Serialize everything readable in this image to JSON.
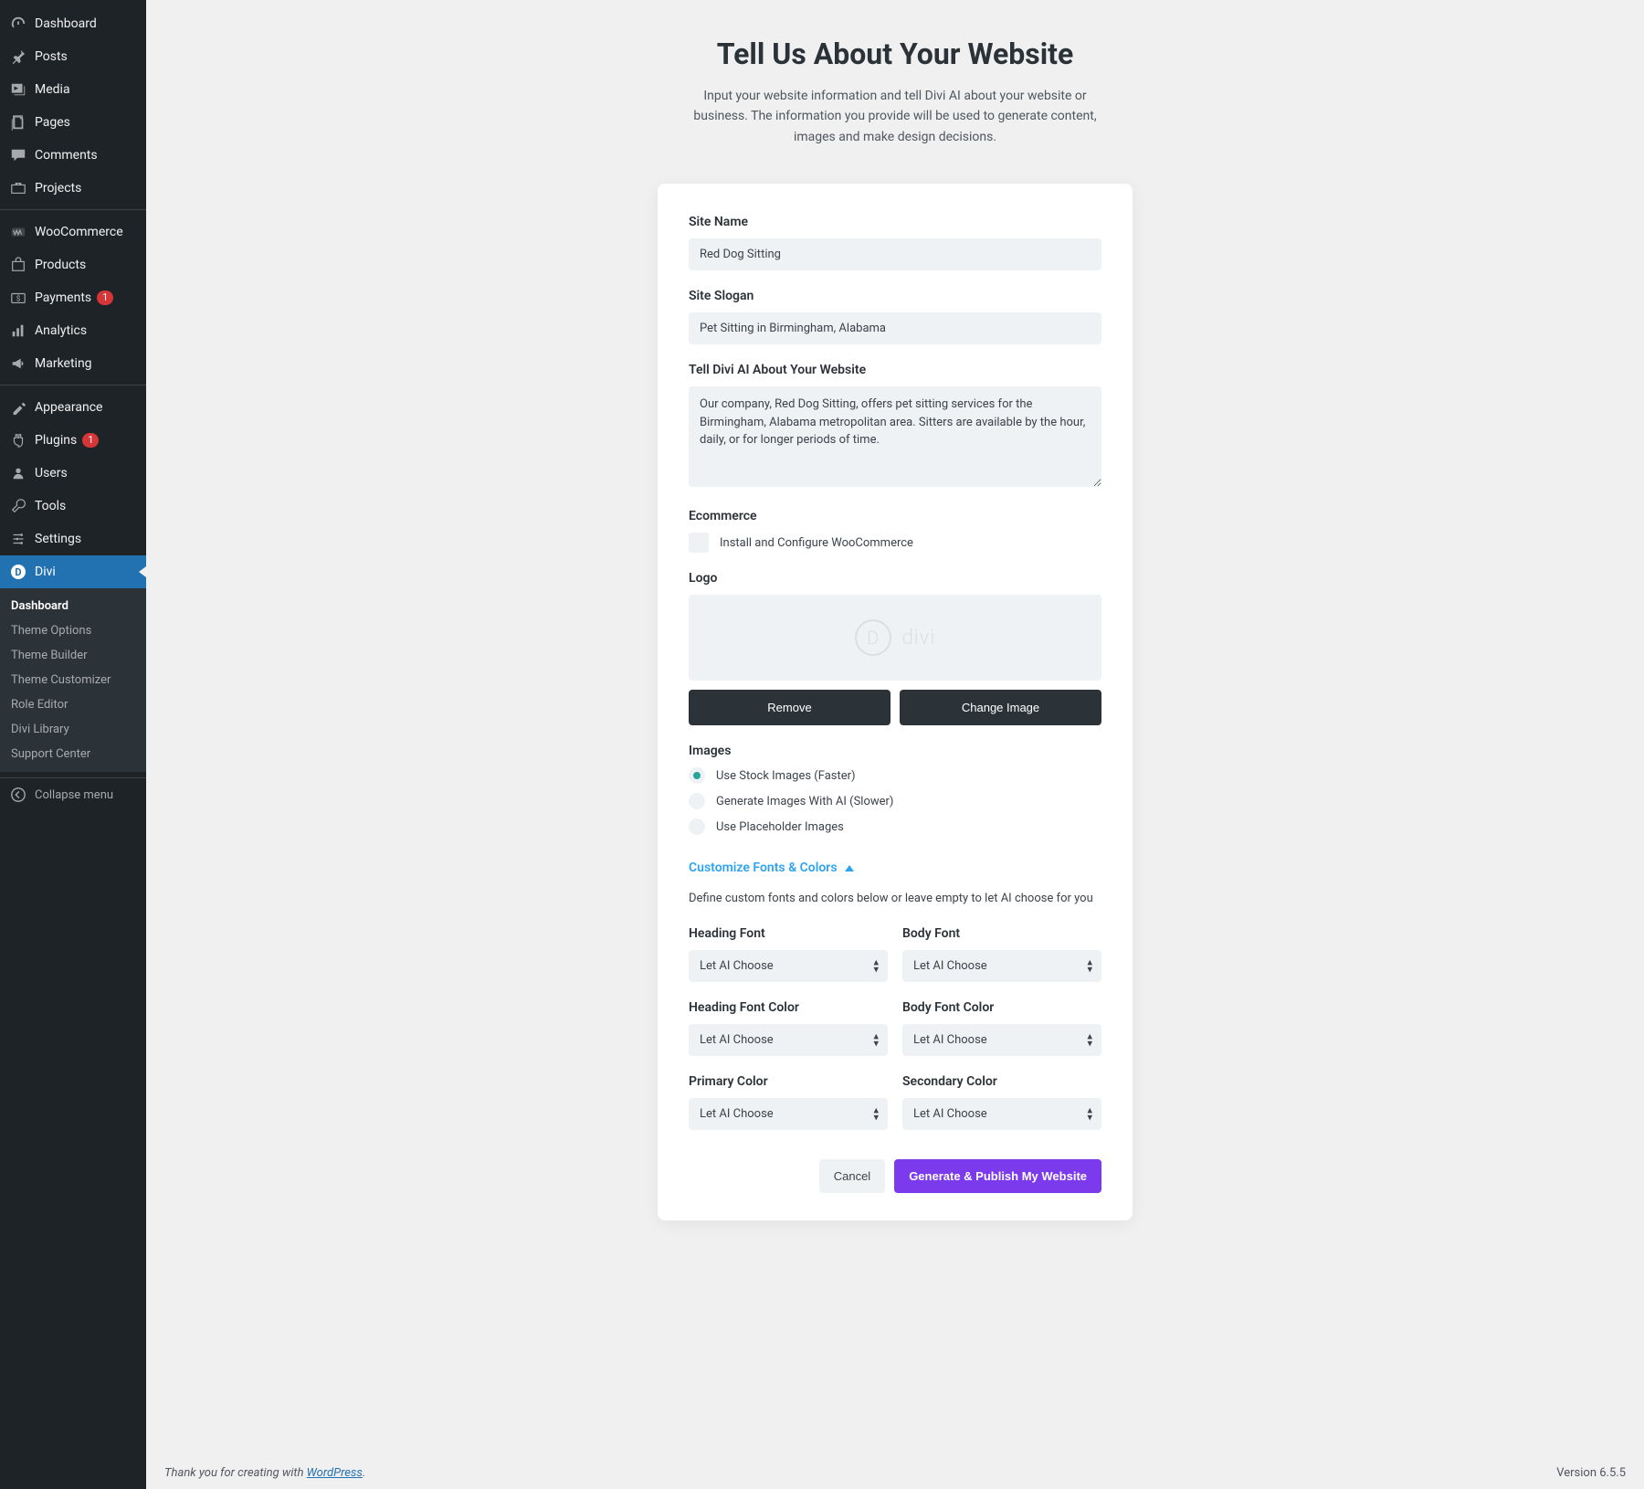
{
  "sidebar": {
    "items": [
      {
        "label": "Dashboard",
        "icon": "dashboard",
        "name": "sidebar-item-dashboard"
      },
      {
        "label": "Posts",
        "icon": "pin",
        "name": "sidebar-item-posts"
      },
      {
        "label": "Media",
        "icon": "media",
        "name": "sidebar-item-media"
      },
      {
        "label": "Pages",
        "icon": "page",
        "name": "sidebar-item-pages"
      },
      {
        "label": "Comments",
        "icon": "comment",
        "name": "sidebar-item-comments"
      },
      {
        "label": "Projects",
        "icon": "portfolio",
        "name": "sidebar-item-projects"
      },
      {
        "label": "WooCommerce",
        "icon": "woo",
        "name": "sidebar-item-woocommerce"
      },
      {
        "label": "Products",
        "icon": "product",
        "name": "sidebar-item-products"
      },
      {
        "label": "Payments",
        "icon": "payments",
        "badge": "1",
        "name": "sidebar-item-payments"
      },
      {
        "label": "Analytics",
        "icon": "analytics",
        "name": "sidebar-item-analytics"
      },
      {
        "label": "Marketing",
        "icon": "marketing",
        "name": "sidebar-item-marketing"
      },
      {
        "label": "Appearance",
        "icon": "appearance",
        "name": "sidebar-item-appearance"
      },
      {
        "label": "Plugins",
        "icon": "plugins",
        "badge": "1",
        "name": "sidebar-item-plugins"
      },
      {
        "label": "Users",
        "icon": "users",
        "name": "sidebar-item-users"
      },
      {
        "label": "Tools",
        "icon": "tools",
        "name": "sidebar-item-tools"
      },
      {
        "label": "Settings",
        "icon": "settings",
        "name": "sidebar-item-settings"
      },
      {
        "label": "Divi",
        "icon": "divi",
        "active": true,
        "name": "sidebar-item-divi"
      }
    ],
    "submenu": [
      {
        "label": "Dashboard",
        "current": true
      },
      {
        "label": "Theme Options"
      },
      {
        "label": "Theme Builder"
      },
      {
        "label": "Theme Customizer"
      },
      {
        "label": "Role Editor"
      },
      {
        "label": "Divi Library"
      },
      {
        "label": "Support Center"
      }
    ],
    "collapse": "Collapse menu"
  },
  "header": {
    "title": "Tell Us About Your Website",
    "subtitle": "Input your website information and tell Divi AI about your website or business. The information you provide will be used to generate content, images and make design decisions."
  },
  "form": {
    "site_name_label": "Site Name",
    "site_name_value": "Red Dog Sitting",
    "site_slogan_label": "Site Slogan",
    "site_slogan_value": "Pet Sitting in Birmingham, Alabama",
    "about_label": "Tell Divi AI About Your Website",
    "about_value": "Our company, Red Dog Sitting, offers pet sitting services for the Birmingham, Alabama metropolitan area. Sitters are available by the hour, daily, or for longer periods of time.",
    "ecommerce_label": "Ecommerce",
    "ecommerce_checkbox_label": "Install and Configure WooCommerce",
    "logo_label": "Logo",
    "logo_placeholder_text": "divi",
    "remove_btn": "Remove",
    "change_btn": "Change Image",
    "images_label": "Images",
    "image_options": [
      {
        "label": "Use Stock Images (Faster)",
        "checked": true
      },
      {
        "label": "Generate Images With AI (Slower)",
        "checked": false
      },
      {
        "label": "Use Placeholder Images",
        "checked": false
      }
    ],
    "customize_toggle": "Customize Fonts & Colors",
    "customize_help": "Define custom fonts and colors below or leave empty to let AI choose for you",
    "selects": [
      {
        "label": "Heading Font",
        "value": "Let AI Choose"
      },
      {
        "label": "Body Font",
        "value": "Let AI Choose"
      },
      {
        "label": "Heading Font Color",
        "value": "Let AI Choose"
      },
      {
        "label": "Body Font Color",
        "value": "Let AI Choose"
      },
      {
        "label": "Primary Color",
        "value": "Let AI Choose"
      },
      {
        "label": "Secondary Color",
        "value": "Let AI Choose"
      }
    ],
    "cancel_btn": "Cancel",
    "submit_btn": "Generate & Publish My Website"
  },
  "footer": {
    "thanks_prefix": "Thank you for creating with ",
    "wp": "WordPress",
    "version": "Version 6.5.5"
  }
}
